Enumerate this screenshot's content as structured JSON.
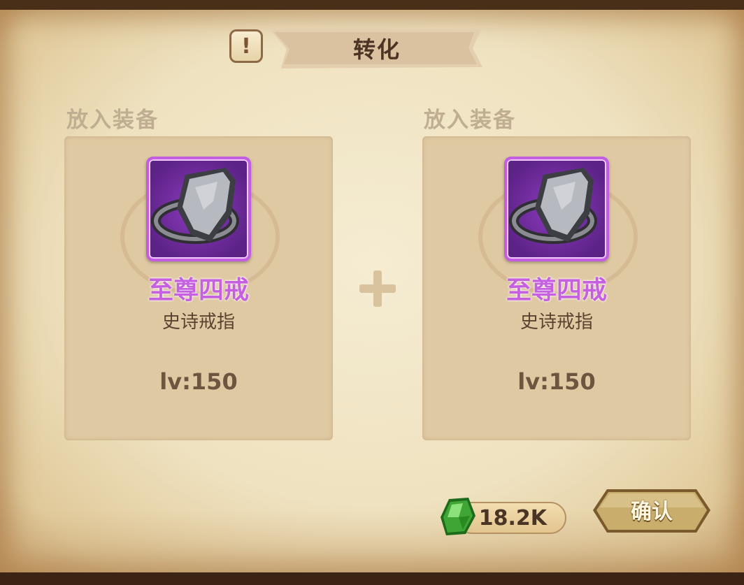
{
  "header": {
    "title": "转化",
    "info_icon": "exclamation-icon"
  },
  "slots": [
    {
      "label": "放入装备",
      "item": {
        "name": "至尊四戒",
        "type": "史诗戒指",
        "level": "lv:150",
        "rarity_color": "#c561df",
        "icon": "shield-ring-icon"
      }
    },
    {
      "label": "放入装备",
      "item": {
        "name": "至尊四戒",
        "type": "史诗戒指",
        "level": "lv:150",
        "rarity_color": "#c561df",
        "icon": "shield-ring-icon"
      }
    }
  ],
  "combine_icon": "plus-icon",
  "currency": {
    "icon": "green-gem-icon",
    "amount": "18.2K"
  },
  "confirm": {
    "label": "确认"
  }
}
